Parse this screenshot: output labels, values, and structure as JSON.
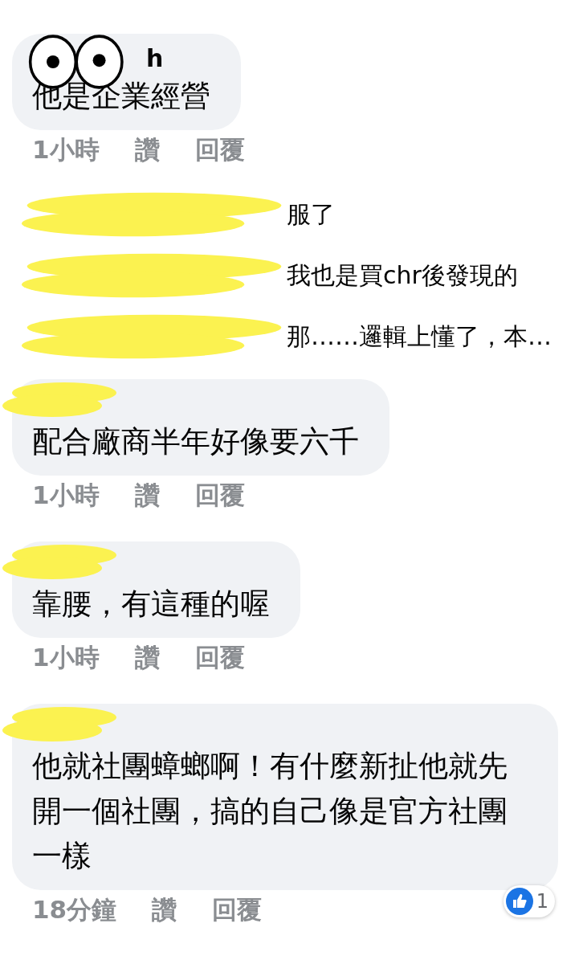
{
  "comments": [
    {
      "author": "h",
      "name_redacted": true,
      "text": "他是企業經營",
      "time": "1小時",
      "like": "讚",
      "reply": "回覆",
      "replies": [
        {
          "text": "服了"
        },
        {
          "text": "我也是買chr後發現的"
        },
        {
          "text": "那……邏輯上懂了，本…"
        }
      ]
    },
    {
      "name_redacted": true,
      "text": "配合廠商半年好像要六千",
      "time": "1小時",
      "like": "讚",
      "reply": "回覆"
    },
    {
      "name_redacted": true,
      "text": "靠腰，有這種的喔",
      "time": "1小時",
      "like": "讚",
      "reply": "回覆"
    },
    {
      "name_redacted": true,
      "text": "他就社團蟑螂啊！有什麼新扯他就先開一個社團，搞的自己像是官方社團一樣",
      "time": "18分鐘",
      "like": "讚",
      "reply": "回覆",
      "reaction_count": "1"
    }
  ]
}
